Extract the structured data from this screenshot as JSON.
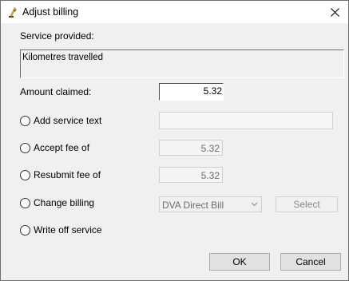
{
  "window": {
    "title": "Adjust billing"
  },
  "service": {
    "label": "Service provided:",
    "value": "Kilometres travelled"
  },
  "amount": {
    "label": "Amount claimed:",
    "value": "5.32"
  },
  "options": {
    "add_service_text": {
      "label": "Add service text",
      "value": ""
    },
    "accept_fee": {
      "label": "Accept fee of",
      "value": "5.32"
    },
    "resubmit_fee": {
      "label": "Resubmit fee of",
      "value": "5.32"
    },
    "change_billing": {
      "label": "Change billing",
      "selected": "DVA Direct Bill",
      "select_label": "Select"
    },
    "write_off": {
      "label": "Write off service"
    }
  },
  "buttons": {
    "ok": "OK",
    "cancel": "Cancel"
  },
  "icons": {
    "app": "app-icon",
    "close": "close-icon",
    "dropdown": "chevron-down-icon"
  }
}
